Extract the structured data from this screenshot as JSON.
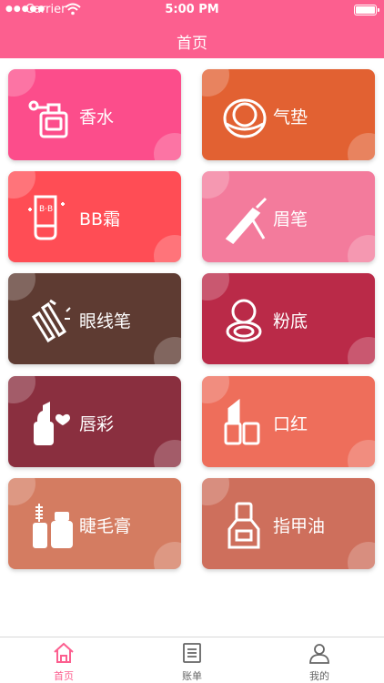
{
  "status_bar": {
    "carrier": "Carrier",
    "time": "5:00 PM"
  },
  "header": {
    "title": "首页"
  },
  "colors": {
    "brand": "#fc5f8f"
  },
  "categories": [
    {
      "label": "香水",
      "icon": "perfume-bottle-icon",
      "color": "#fc4d8b"
    },
    {
      "label": "气垫",
      "icon": "cushion-compact-icon",
      "color": "#e26132"
    },
    {
      "label": "BB霜",
      "icon": "bb-cream-tube-icon",
      "color": "#ff4d55"
    },
    {
      "label": "眉笔",
      "icon": "eyebrow-pencil-icon",
      "color": "#f37b9c"
    },
    {
      "label": "眼线笔",
      "icon": "eyeliner-icon",
      "color": "#5e3b32"
    },
    {
      "label": "粉底",
      "icon": "foundation-compact-icon",
      "color": "#ba2a48"
    },
    {
      "label": "唇彩",
      "icon": "lip-gloss-heart-icon",
      "color": "#8a2f3f"
    },
    {
      "label": "口红",
      "icon": "lipstick-icon",
      "color": "#ee6e5b"
    },
    {
      "label": "睫毛膏",
      "icon": "mascara-icon",
      "color": "#d47c61"
    },
    {
      "label": "指甲油",
      "icon": "nail-polish-icon",
      "color": "#ce6f5c"
    }
  ],
  "tabs": [
    {
      "label": "首页",
      "icon": "home-icon",
      "active": true
    },
    {
      "label": "账单",
      "icon": "bill-icon",
      "active": false
    },
    {
      "label": "我的",
      "icon": "user-icon",
      "active": false
    }
  ]
}
